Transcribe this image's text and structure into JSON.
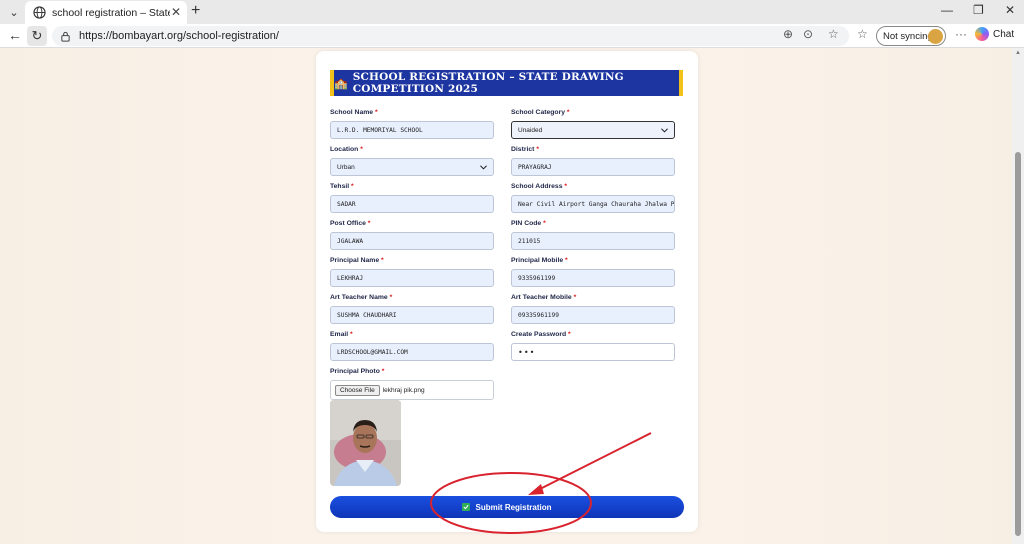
{
  "browser": {
    "tab_title": "school registration – State Level D",
    "url": "https://bombayart.org/school-registration/",
    "sync_label": "Not syncing",
    "chat_label": "Chat"
  },
  "form": {
    "banner_title": "SCHOOL REGISTRATION – STATE DRAWING COMPETITION 2025",
    "fields": {
      "school_name": {
        "label": "School Name",
        "value": "L.R.D. MEMORIYAL SCHOOL"
      },
      "school_category": {
        "label": "School Category",
        "value": "Unaided"
      },
      "location": {
        "label": "Location",
        "value": "Urban"
      },
      "district": {
        "label": "District",
        "value": "PRAYAGRAJ"
      },
      "tehsil": {
        "label": "Tehsil",
        "value": "SADAR"
      },
      "school_address": {
        "label": "School Address",
        "value": "Near Civil Airport Ganga Chauraha Jhalwa Prayagraj"
      },
      "post_office": {
        "label": "Post Office",
        "value": "JGALAWA"
      },
      "pin_code": {
        "label": "PIN Code",
        "value": "211015"
      },
      "principal_name": {
        "label": "Principal Name",
        "value": "LEKHRAJ"
      },
      "principal_mobile": {
        "label": "Principal Mobile",
        "value": "9335961199"
      },
      "art_teacher_name": {
        "label": "Art Teacher Name",
        "value": "SUSHMA CHAUDHARI"
      },
      "art_teacher_mobile": {
        "label": "Art Teacher Mobile",
        "value": "09335961199"
      },
      "email": {
        "label": "Email",
        "value": "LRDSCHOOL@GMAIL.COM"
      },
      "create_password": {
        "label": "Create Password",
        "value": "•••"
      },
      "principal_photo": {
        "label": "Principal Photo",
        "button": "Choose File",
        "file_name": "lekhraj pik.png"
      }
    },
    "required_mark": "*",
    "submit_label": "Submit Registration"
  },
  "colors": {
    "banner_bg": "#1d35a0",
    "banner_accent": "#f2c21b",
    "submit_bg": "#1240c9",
    "annotation": "#d9232e"
  }
}
